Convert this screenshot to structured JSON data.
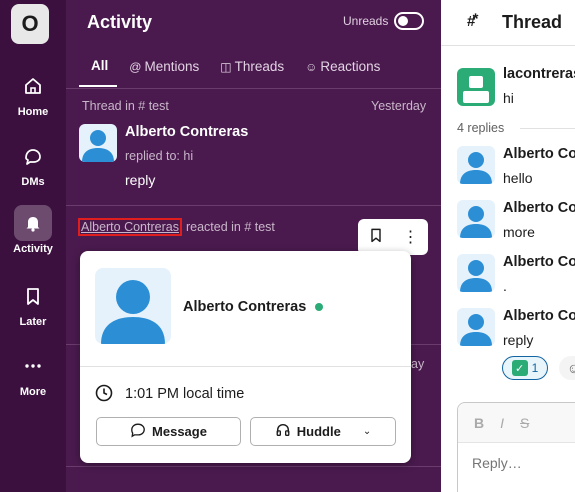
{
  "rail": {
    "workspace_initial": "O",
    "items": [
      {
        "label": "Home",
        "icon": "home-icon"
      },
      {
        "label": "DMs",
        "icon": "dms-icon"
      },
      {
        "label": "Activity",
        "icon": "bell-icon"
      },
      {
        "label": "Later",
        "icon": "bookmark-icon"
      },
      {
        "label": "More",
        "icon": "more-icon"
      }
    ]
  },
  "activity": {
    "title": "Activity",
    "unreads_label": "Unreads",
    "unreads_on": false,
    "tabs": [
      {
        "label": "All",
        "icon": ""
      },
      {
        "label": "Mentions",
        "icon": "@"
      },
      {
        "label": "Threads",
        "icon": "thread-icon"
      },
      {
        "label": "Reactions",
        "icon": "smiley-icon"
      }
    ],
    "items": [
      {
        "context": "Thread in # test",
        "time": "Yesterday",
        "name": "Alberto Contreras",
        "meta": "replied to: hi",
        "text": "reply"
      },
      {
        "actor": "Alberto Contreras",
        "action": "reacted in # test",
        "time_partial": "ay"
      }
    ]
  },
  "profile_card": {
    "name": "Alberto Contreras",
    "local_time": "1:01 PM local time",
    "message_label": "Message",
    "huddle_label": "Huddle",
    "status_color": "#2bac76"
  },
  "thread": {
    "title": "Thread",
    "original": {
      "name": "lacontreras",
      "text": "hi"
    },
    "replies_label": "4 replies",
    "replies": [
      {
        "name": "Alberto Contreras",
        "text": "hello"
      },
      {
        "name": "Alberto Contreras",
        "text": "more"
      },
      {
        "name": "Alberto Contreras",
        "text": "."
      },
      {
        "name": "Alberto Contreras",
        "text": "reply"
      }
    ],
    "reaction": {
      "emoji": "✅",
      "count": "1"
    },
    "composer_placeholder": "Reply…",
    "format_tools": [
      "B",
      "I",
      "S"
    ]
  },
  "colors": {
    "rail_bg": "#3b0f3e",
    "pane_bg": "#4a1a4e",
    "highlight_box": "#e01e1e",
    "accent_blue": "#1264a3"
  }
}
